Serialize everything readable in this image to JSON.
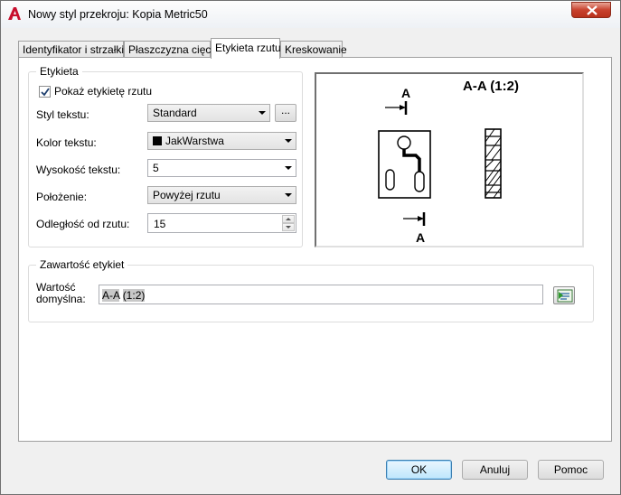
{
  "window": {
    "title": "Nowy styl przekroju: Kopia Metric50"
  },
  "icons": {
    "app": "autocad-a-icon",
    "close": "close-icon",
    "check": "checkmark-icon",
    "field": "insert-field-icon"
  },
  "colors": {
    "close_button": "#c8422e",
    "default_button_border": "#3c7fb1"
  },
  "tabs": [
    {
      "label": "Identyfikator i strzałki",
      "active": false
    },
    {
      "label": "Płaszczyzna cięcia",
      "active": false
    },
    {
      "label": "Etykieta rzutu",
      "active": true
    },
    {
      "label": "Kreskowanie",
      "active": false
    }
  ],
  "label_group": {
    "title": "Etykieta",
    "show_label": {
      "label": "Pokaż etykietę rzutu",
      "checked": true
    },
    "text_style": {
      "label": "Styl tekstu:",
      "value": "Standard",
      "browse": "..."
    },
    "text_color": {
      "label": "Kolor tekstu:",
      "value": "JakWarstwa",
      "swatch": "#000000"
    },
    "text_height": {
      "label": "Wysokość tekstu:",
      "value": "5"
    },
    "position": {
      "label": "Położenie:",
      "value": "Powyżej rzutu"
    },
    "offset": {
      "label": "Odległość od rzutu:",
      "value": "15"
    }
  },
  "preview": {
    "title_label": "A-A (1:2)",
    "marker_top": "A",
    "marker_bottom": "A"
  },
  "contents_group": {
    "title": "Zawartość etykiet",
    "default_label_line1": "Wartość",
    "default_label_line2": "domyślna:",
    "field1": "A-A",
    "field2": "(1:2)"
  },
  "buttons": {
    "ok": "OK",
    "cancel": "Anuluj",
    "help": "Pomoc"
  }
}
